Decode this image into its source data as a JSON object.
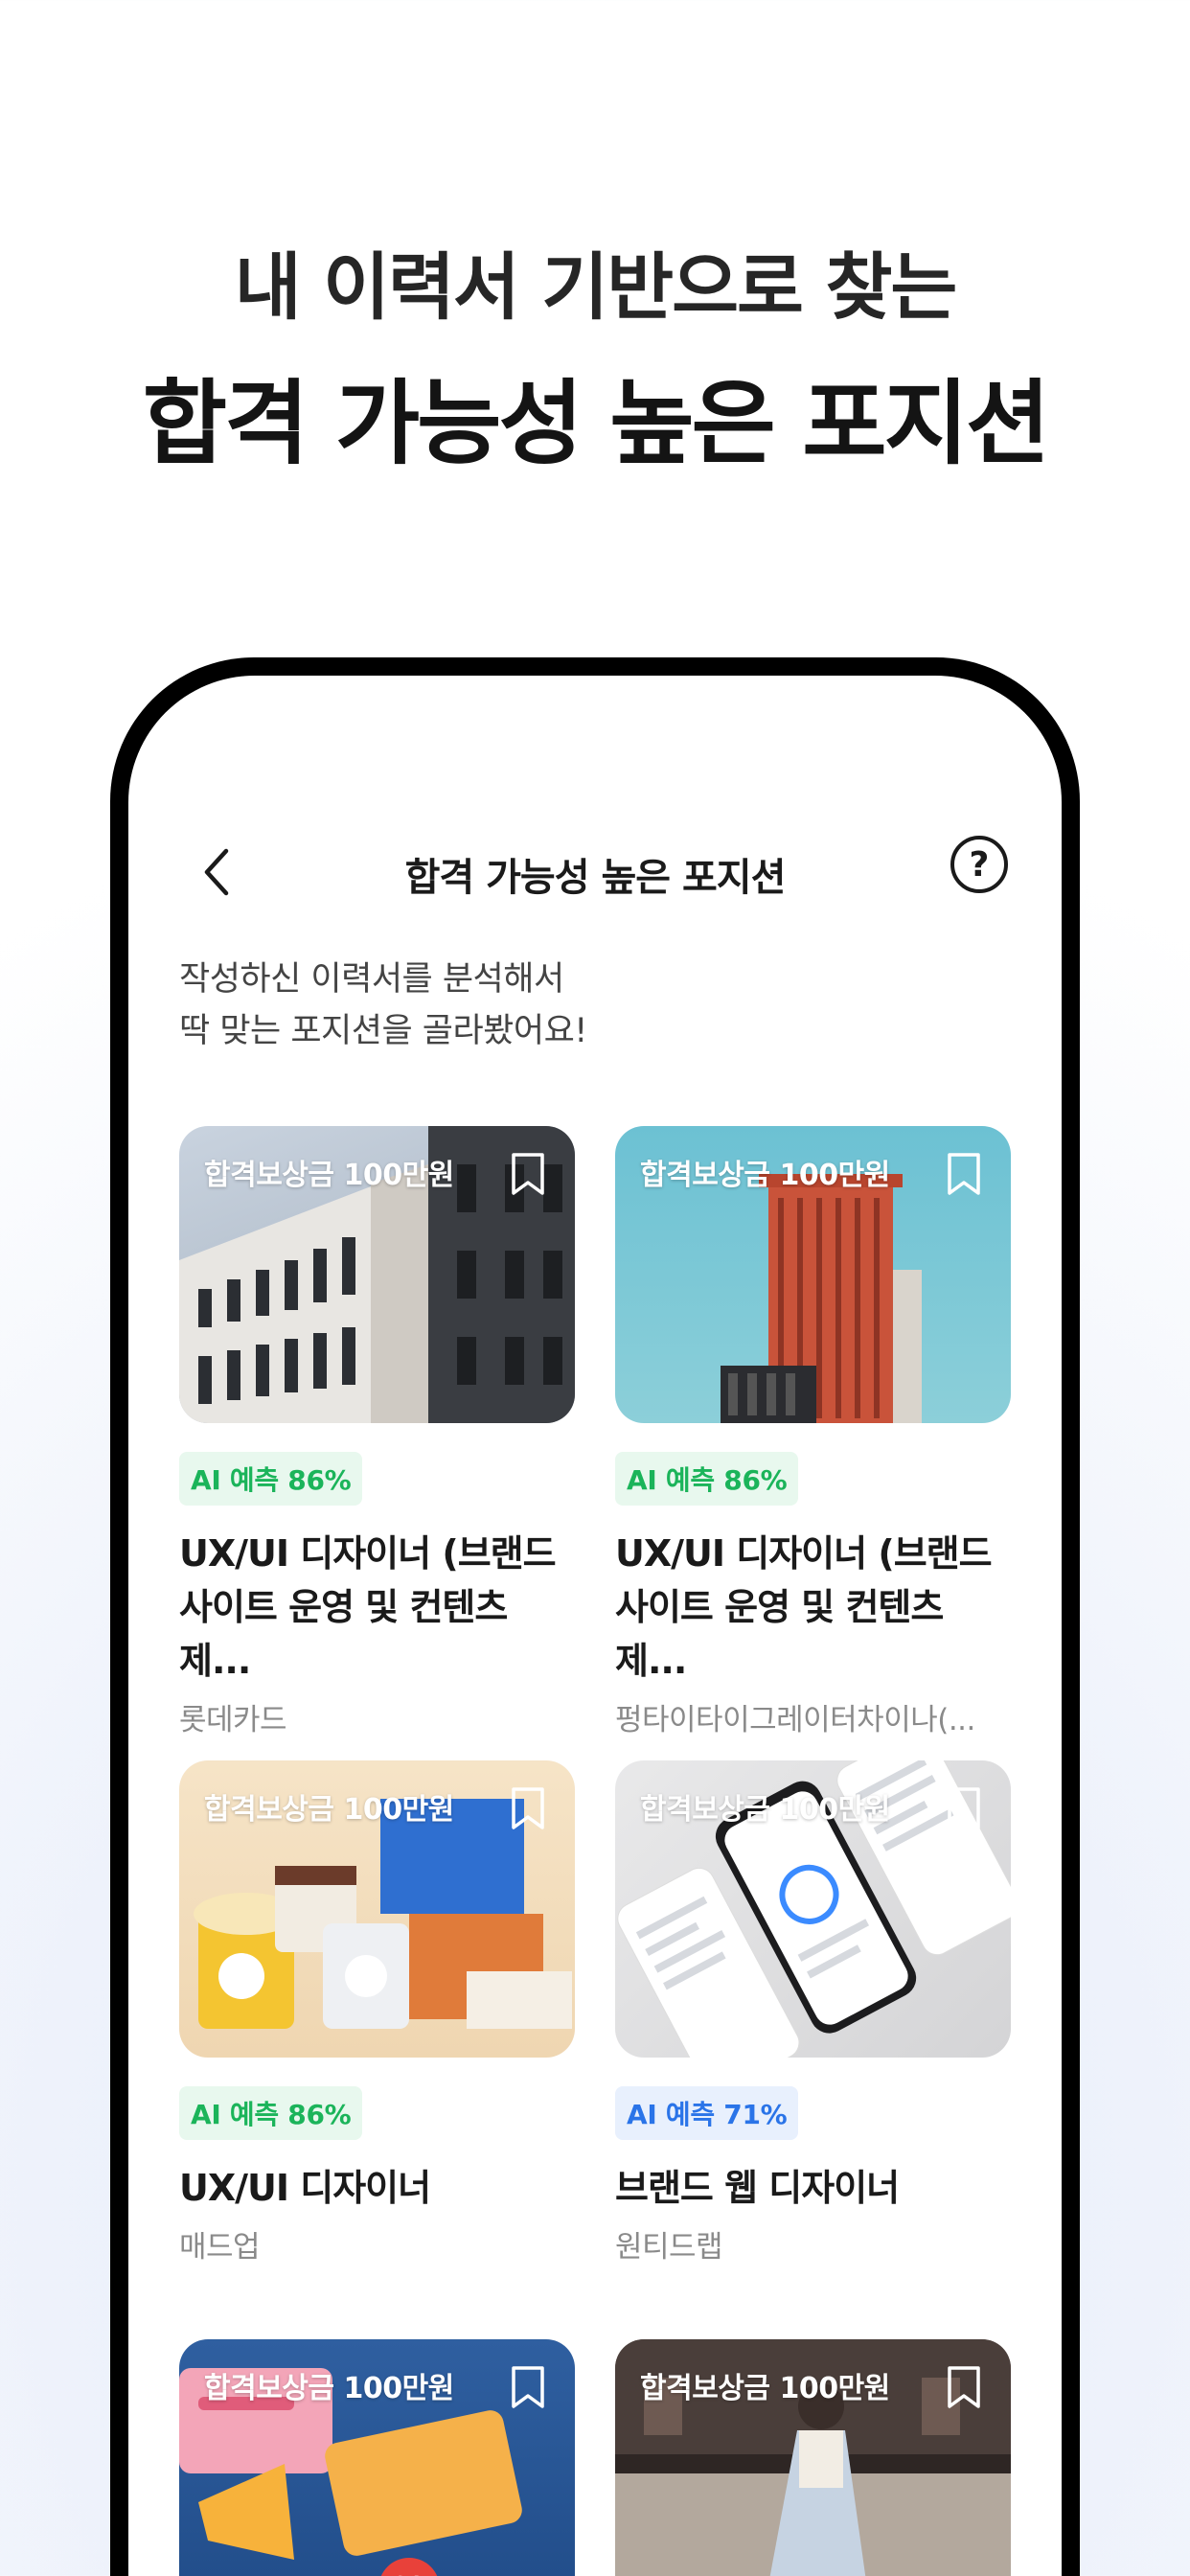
{
  "headline": {
    "line1": "내 이력서 기반으로 찾는",
    "line2": "합격 가능성 높은 포지션"
  },
  "nav": {
    "back_icon": "chevron-left-icon",
    "title": "합격 가능성 높은 포지션",
    "help_icon": "question-circle-icon",
    "help_glyph": "?"
  },
  "intro": {
    "line1": "작성하신 이력서를 분석해서",
    "line2": "딱 맞는 포지션을 골라봤어요!"
  },
  "jobs": [
    {
      "tag": "합격보상금 100만원",
      "badge": "AI 예측 86%",
      "badge_color": "green",
      "title": "UX/UI 디자이너 (브랜드 사이트 운영 및 컨텐츠 제...",
      "company": "롯데카드"
    },
    {
      "tag": "합격보상금 100만원",
      "badge": "AI 예측 86%",
      "badge_color": "green",
      "title": "UX/UI 디자이너 (브랜드 사이트 운영 및 컨텐츠 제...",
      "company": "펑타이타이그레이터차이나(..."
    },
    {
      "tag": "합격보상금 100만원",
      "badge": "AI 예측 86%",
      "badge_color": "green",
      "title": "UX/UI 디자이너",
      "company": "매드업"
    },
    {
      "tag": "합격보상금 100만원",
      "badge": "AI 예측 71%",
      "badge_color": "blue",
      "title": "브랜드 웹 디자이너",
      "company": "원티드랩"
    },
    {
      "tag": "합격보상금 100만원",
      "badge": "",
      "badge_color": "green",
      "title": "",
      "company": ""
    },
    {
      "tag": "합격보상금 100만원",
      "badge": "",
      "badge_color": "green",
      "title": "",
      "company": ""
    }
  ],
  "colors": {
    "badge_green_text": "#1bb45a",
    "badge_blue_text": "#2a74e8",
    "phone_frame": "#000000"
  }
}
